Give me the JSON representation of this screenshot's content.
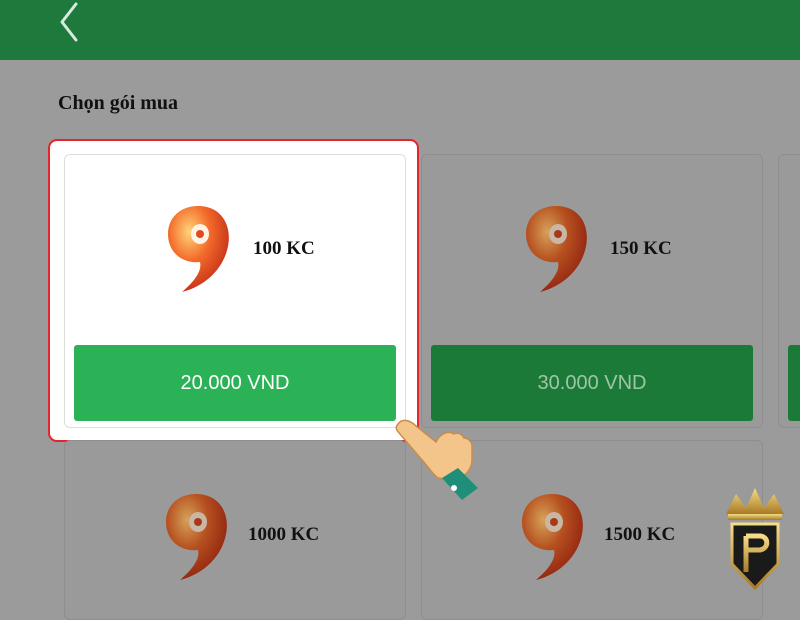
{
  "header": {
    "back_icon": "chevron-left-icon"
  },
  "section": {
    "title": "Chọn gói mua"
  },
  "packages": [
    {
      "amount": "100 KC",
      "price": "20.000 VND",
      "selected": true
    },
    {
      "amount": "150 KC",
      "price": "30.000 VND",
      "selected": false
    },
    {
      "amount": "1000 KC",
      "price": "",
      "selected": false
    },
    {
      "amount": "1500 KC",
      "price": "",
      "selected": false
    }
  ],
  "colors": {
    "header": "#1e7a3c",
    "button": "#2cb256",
    "highlight": "#e2262b"
  },
  "icons": {
    "gem": "currency-gem-icon",
    "pointer": "pointing-hand-icon",
    "brand": "crown-logo"
  }
}
